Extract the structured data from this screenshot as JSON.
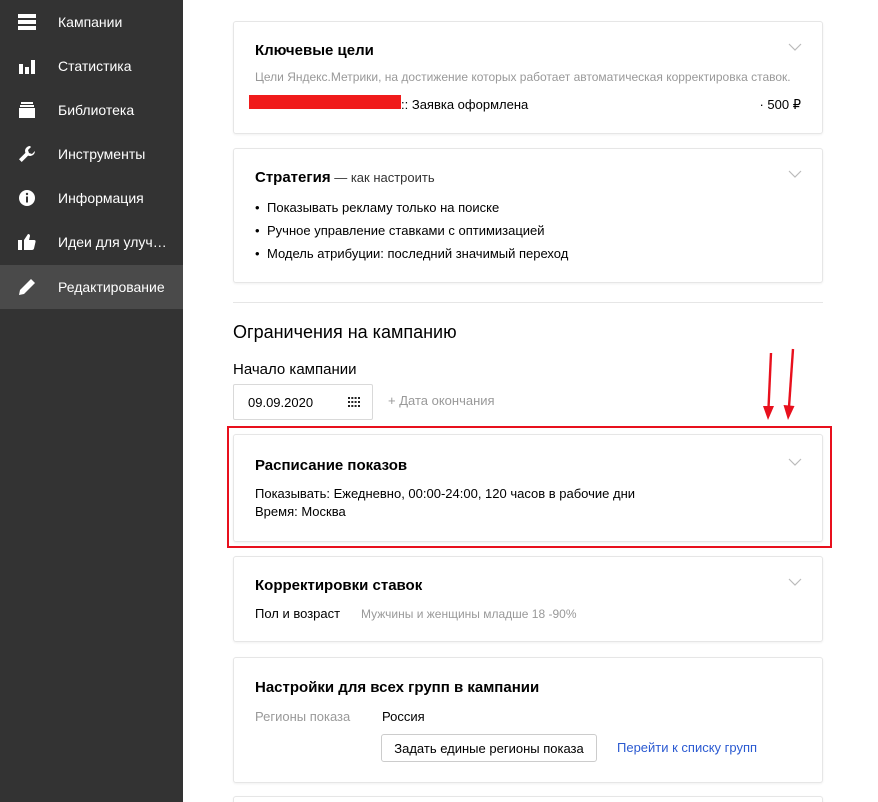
{
  "sidebar": {
    "items": [
      {
        "label": "Кампании",
        "icon": "list-icon"
      },
      {
        "label": "Статистика",
        "icon": "bar-chart-icon"
      },
      {
        "label": "Библиотека",
        "icon": "library-icon"
      },
      {
        "label": "Инструменты",
        "icon": "wrench-icon"
      },
      {
        "label": "Информация",
        "icon": "info-icon"
      },
      {
        "label": "Идеи для улучшения",
        "icon": "thumbs-up-icon"
      },
      {
        "label": "Редактирование",
        "icon": "pencil-icon",
        "active": true
      }
    ]
  },
  "goals": {
    "title": "Ключевые цели",
    "description": "Цели Яндекс.Метрики, на достижение которых работает автоматическая корректировка ставок.",
    "goal_name": ":: Заявка оформлена",
    "goal_value": "· 500 ₽"
  },
  "strategy": {
    "title": "Стратегия",
    "hint": " — как настроить",
    "bullets": [
      "Показывать рекламу только на поиске",
      "Ручное управление ставками с оптимизацией",
      "Модель атрибуции: последний значимый переход"
    ]
  },
  "restrictions": {
    "title": "Ограничения на кампанию",
    "start_label": "Начало кампании",
    "start_date": "09.09.2020",
    "end_date_label": "+ Дата окончания"
  },
  "schedule": {
    "title": "Расписание показов",
    "line1": "Показывать: Ежедневно, 00:00-24:00, 120 часов в рабочие дни",
    "line2": "Время: Москва"
  },
  "bids": {
    "title": "Корректировки ставок",
    "label": "Пол и возраст",
    "value": "Мужчины и женщины младше 18 -90%"
  },
  "groups": {
    "title": "Настройки для всех групп в кампании",
    "regions_label": "Регионы показа",
    "regions_value": "Россия",
    "button_label": "Задать единые регионы показа",
    "link_label": "Перейти к списку групп"
  },
  "colors": {
    "sidebar_bg": "#333333",
    "annotation_red": "#e8101d",
    "link_blue": "#2b5ad1"
  }
}
